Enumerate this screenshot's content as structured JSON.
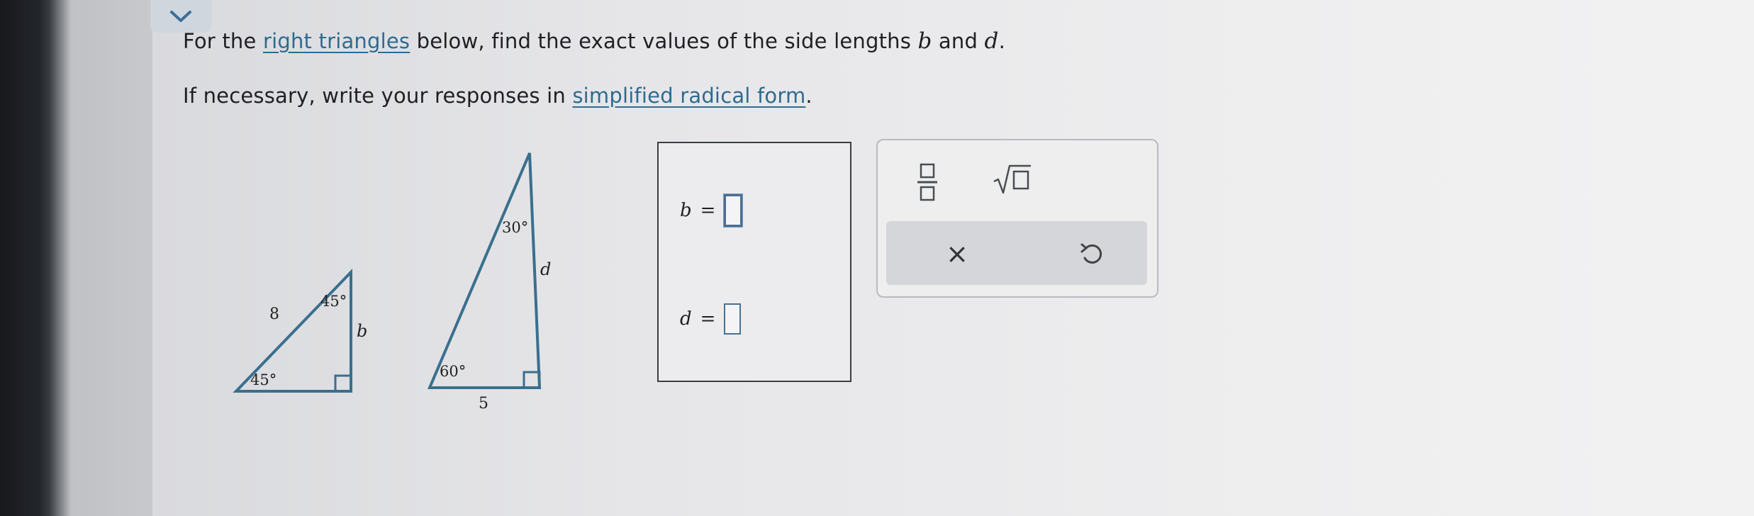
{
  "question": {
    "line1_prefix": "For the ",
    "line1_link": "right triangles",
    "line1_mid": " below, find the exact values of the side lengths ",
    "var_b": "b",
    "line1_and": " and ",
    "var_d": "d",
    "line1_end": ".",
    "line2_prefix": "If necessary, write your responses in ",
    "line2_link": "simplified radical form",
    "line2_end": "."
  },
  "figure1": {
    "side_label": "8",
    "angle_top": "45°",
    "angle_bottom": "45°",
    "side_unknown": "b"
  },
  "figure2": {
    "angle_top": "30°",
    "angle_bottom": "60°",
    "side_unknown": "d",
    "base_label": "5"
  },
  "answers": {
    "b_label": "b",
    "d_label": "d",
    "equals": "="
  },
  "keypad": {
    "clear_symbol": "×",
    "icons": [
      "fraction-icon",
      "sqrt-icon",
      "undo-icon"
    ]
  },
  "colors": {
    "link": "#2f6b8f",
    "triangle_stroke": "#3a6f8e",
    "input_border": "#4a6f93"
  }
}
